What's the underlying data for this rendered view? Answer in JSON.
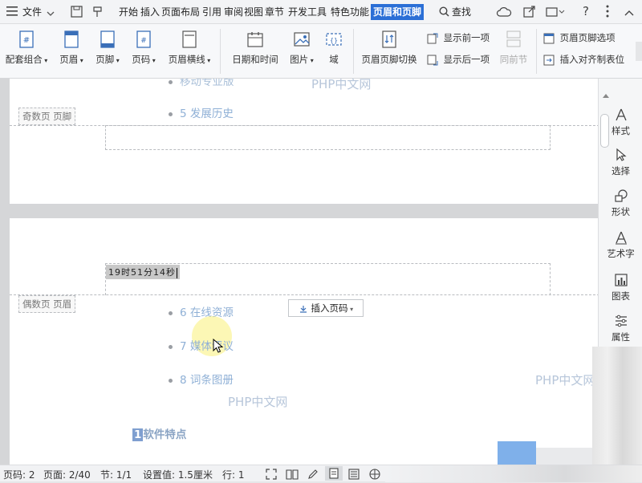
{
  "titlebar": {
    "file_menu": "文件",
    "tabs": [
      "开始",
      "插入",
      "页面布局",
      "引用",
      "审阅",
      "视图",
      "章节",
      "开发工具",
      "特色功能"
    ],
    "active_tab": "页眉和页脚",
    "search": "查找"
  },
  "ribbon": {
    "big_buttons": [
      {
        "label": "配套组合",
        "icon": "doc-template-icon"
      },
      {
        "label": "页眉",
        "icon": "header-icon"
      },
      {
        "label": "页脚",
        "icon": "footer-icon"
      },
      {
        "label": "页码",
        "icon": "page-number-icon"
      },
      {
        "label": "页眉横线",
        "icon": "header-line-icon"
      },
      {
        "label": "日期和时间",
        "icon": "calendar-icon"
      },
      {
        "label": "图片",
        "icon": "image-icon"
      },
      {
        "label": "域",
        "icon": "field-icon"
      },
      {
        "label": "页眉页脚切换",
        "icon": "switch-icon"
      }
    ],
    "small_buttons": {
      "show_prev": "显示前一项",
      "show_next": "显示后一项",
      "prev_section": "同前节",
      "hf_options": "页眉页脚选项",
      "insert_align_tab": "插入对齐制表位"
    }
  },
  "document": {
    "page1": {
      "top_item": "移动专业版",
      "item5": "5 发展历史",
      "footer_tag": "奇数页 页脚"
    },
    "page2": {
      "header_text": "19时51分14秒",
      "header_tag": "偶数页 页眉",
      "insert_page_number": "插入页码",
      "items": [
        "6 在线资源",
        "7 媒体评议",
        "8 词条图册"
      ],
      "heading_num": "1",
      "heading_text": "软件特点"
    },
    "watermarks": [
      "PHP中文网",
      "PHP中文网",
      "PHP中文网"
    ]
  },
  "right_panel": [
    {
      "label": "样式",
      "icon": "style-icon"
    },
    {
      "label": "选择",
      "icon": "select-cursor-icon"
    },
    {
      "label": "形状",
      "icon": "shape-icon"
    },
    {
      "label": "艺术字",
      "icon": "wordart-icon"
    },
    {
      "label": "图表",
      "icon": "chart-icon"
    },
    {
      "label": "属性",
      "icon": "properties-icon"
    }
  ],
  "statusbar": {
    "page_code": "页码: 2",
    "page": "页面: 2/40",
    "section": "节: 1/1",
    "setting": "设置值: 1.5厘米",
    "row": "行: 1"
  }
}
